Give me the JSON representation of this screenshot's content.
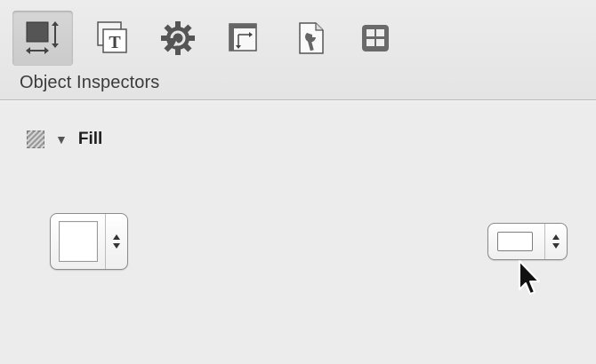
{
  "toolbar": {
    "title": "Object Inspectors",
    "buttons": [
      {
        "name": "graphic-inspector",
        "icon": "graphic-inspector-icon",
        "active": true
      },
      {
        "name": "text-inspector",
        "icon": "text-inspector-icon",
        "active": false
      },
      {
        "name": "action-inspector",
        "icon": "gear-icon",
        "active": false
      },
      {
        "name": "layout-inspector",
        "icon": "layout-inspector-icon",
        "active": false
      },
      {
        "name": "document-inspector",
        "icon": "document-inspector-icon",
        "active": false
      },
      {
        "name": "grid-inspector",
        "icon": "grid-icon",
        "active": false
      }
    ]
  },
  "fill_section": {
    "title": "Fill",
    "icon": "fill-pattern-icon",
    "disclosure": "▼",
    "fill_color": "#ffffff",
    "shape_preset": "rectangle"
  }
}
